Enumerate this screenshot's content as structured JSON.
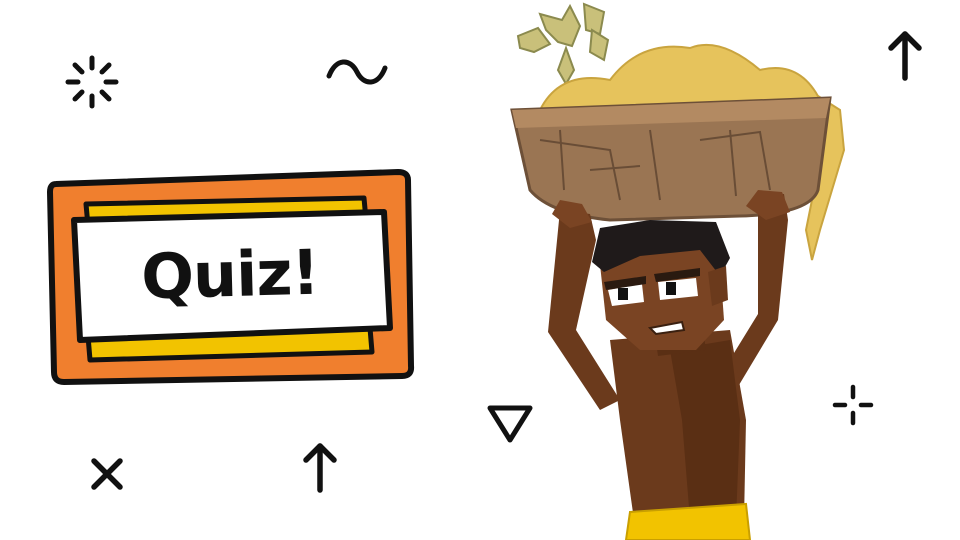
{
  "card": {
    "title": "Quiz!"
  },
  "icons": [
    "sparkle-icon",
    "tilde-icon",
    "arrow-up-icon",
    "arrow-up-icon",
    "times-icon",
    "triangle-down-icon",
    "crosshair-icon"
  ],
  "colors": {
    "background": "#ffffff",
    "card_outer": "#f07f2e",
    "card_band": "#f2c300",
    "card_inner": "#ffffff",
    "ink": "#111111",
    "skin": "#6b3a1c",
    "basket": "#9a7553",
    "crop": "#e6c35c",
    "cloth": "#f2c300"
  }
}
